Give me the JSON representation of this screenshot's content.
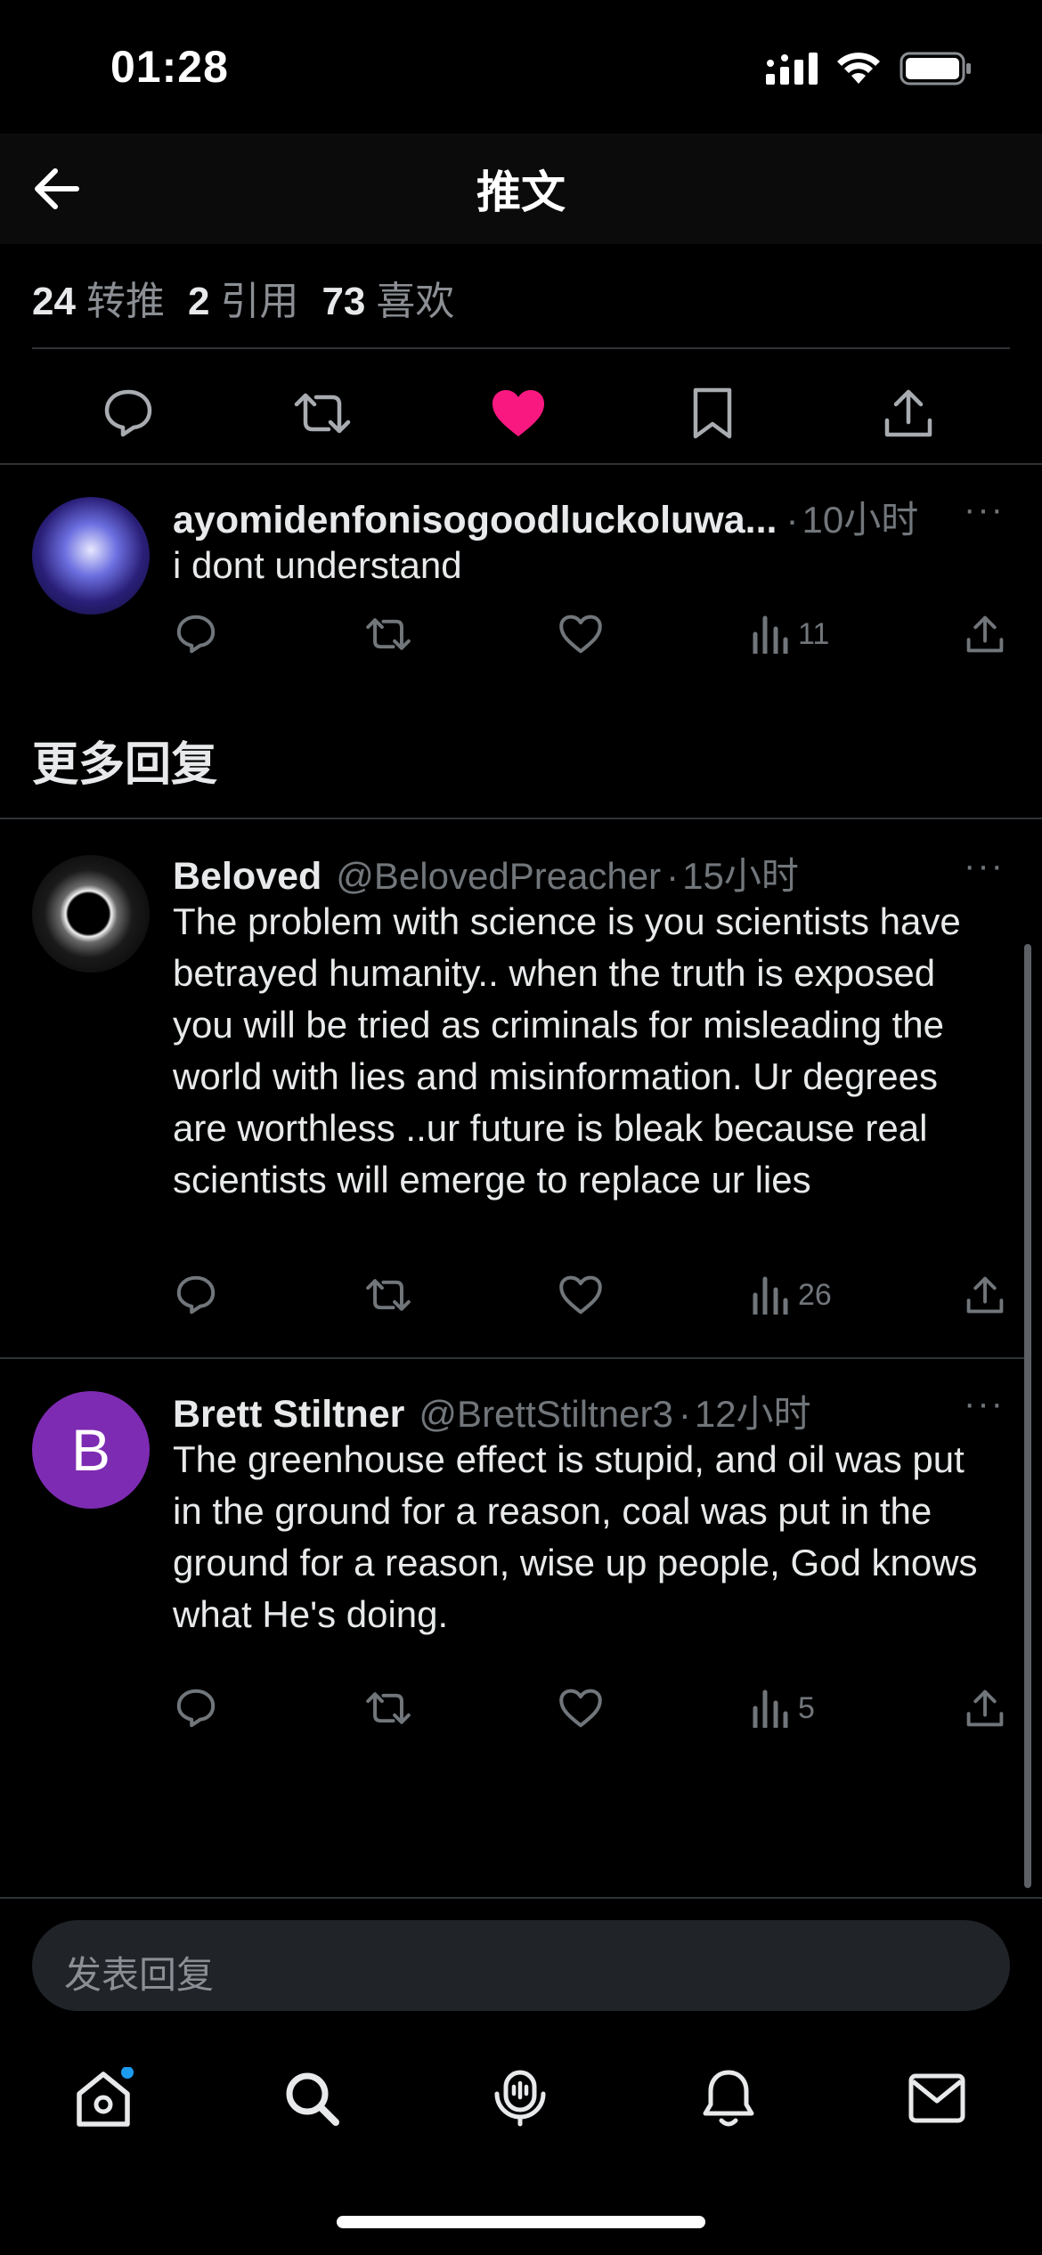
{
  "status_bar": {
    "time": "01:28"
  },
  "header": {
    "title": "推文"
  },
  "stats": [
    {
      "count": "24",
      "label": "转推"
    },
    {
      "count": "2",
      "label": "引用"
    },
    {
      "count": "73",
      "label": "喜欢"
    }
  ],
  "colors": {
    "like_active": "#f91880",
    "avatar_purple": "#7e2bb3",
    "notification_dot": "#1d9bf0"
  },
  "replies": [
    {
      "name": "ayomidenfonisogoodluckoluwa...",
      "handle": "",
      "time": "10小时",
      "text": "i dont understand",
      "views": "11"
    }
  ],
  "section_title": "更多回复",
  "more_replies": [
    {
      "name": "Beloved",
      "handle": "@BelovedPreacher",
      "time": "15小时",
      "text": "The problem with science is you scientists have betrayed humanity.. when the truth is exposed you will be tried as criminals for misleading the world with lies and misinformation. Ur degrees are worthless ..ur future is bleak because real scientists will emerge to replace ur lies",
      "views": "26"
    },
    {
      "name": "Brett Stiltner",
      "handle": "@BrettStiltner3",
      "time": "12小时",
      "avatar_letter": "B",
      "text": "The greenhouse effect is stupid, and oil was put in the ground for a reason, coal was put in the ground for a reason, wise up people, God knows what He's doing.",
      "views": "5"
    }
  ],
  "reply_box": {
    "placeholder": "发表回复"
  },
  "more_menu": "···",
  "separator": "·"
}
